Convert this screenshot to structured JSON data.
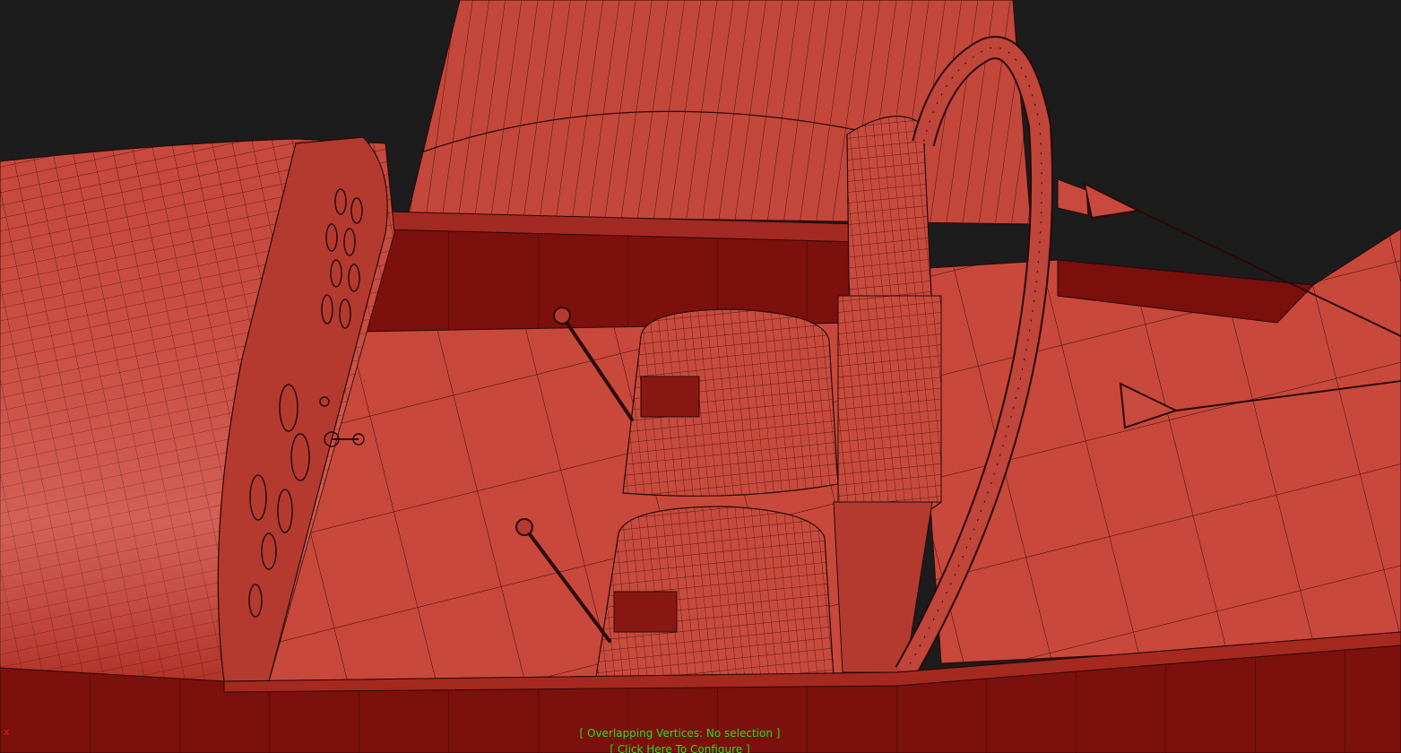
{
  "viewport": {
    "overlay_status": "[ Overlapping Vertices: No selection ]",
    "overlay_configure": "[ Click Here To Configure ]",
    "axis_label": "x"
  },
  "colors": {
    "background": "#1c1c1c",
    "mesh_face": "#c4473b",
    "mesh_shadow": "#7a0f0c",
    "wire": "#2a0806",
    "overlay_text": "#1fe01f",
    "axis_x": "#e0201f"
  }
}
